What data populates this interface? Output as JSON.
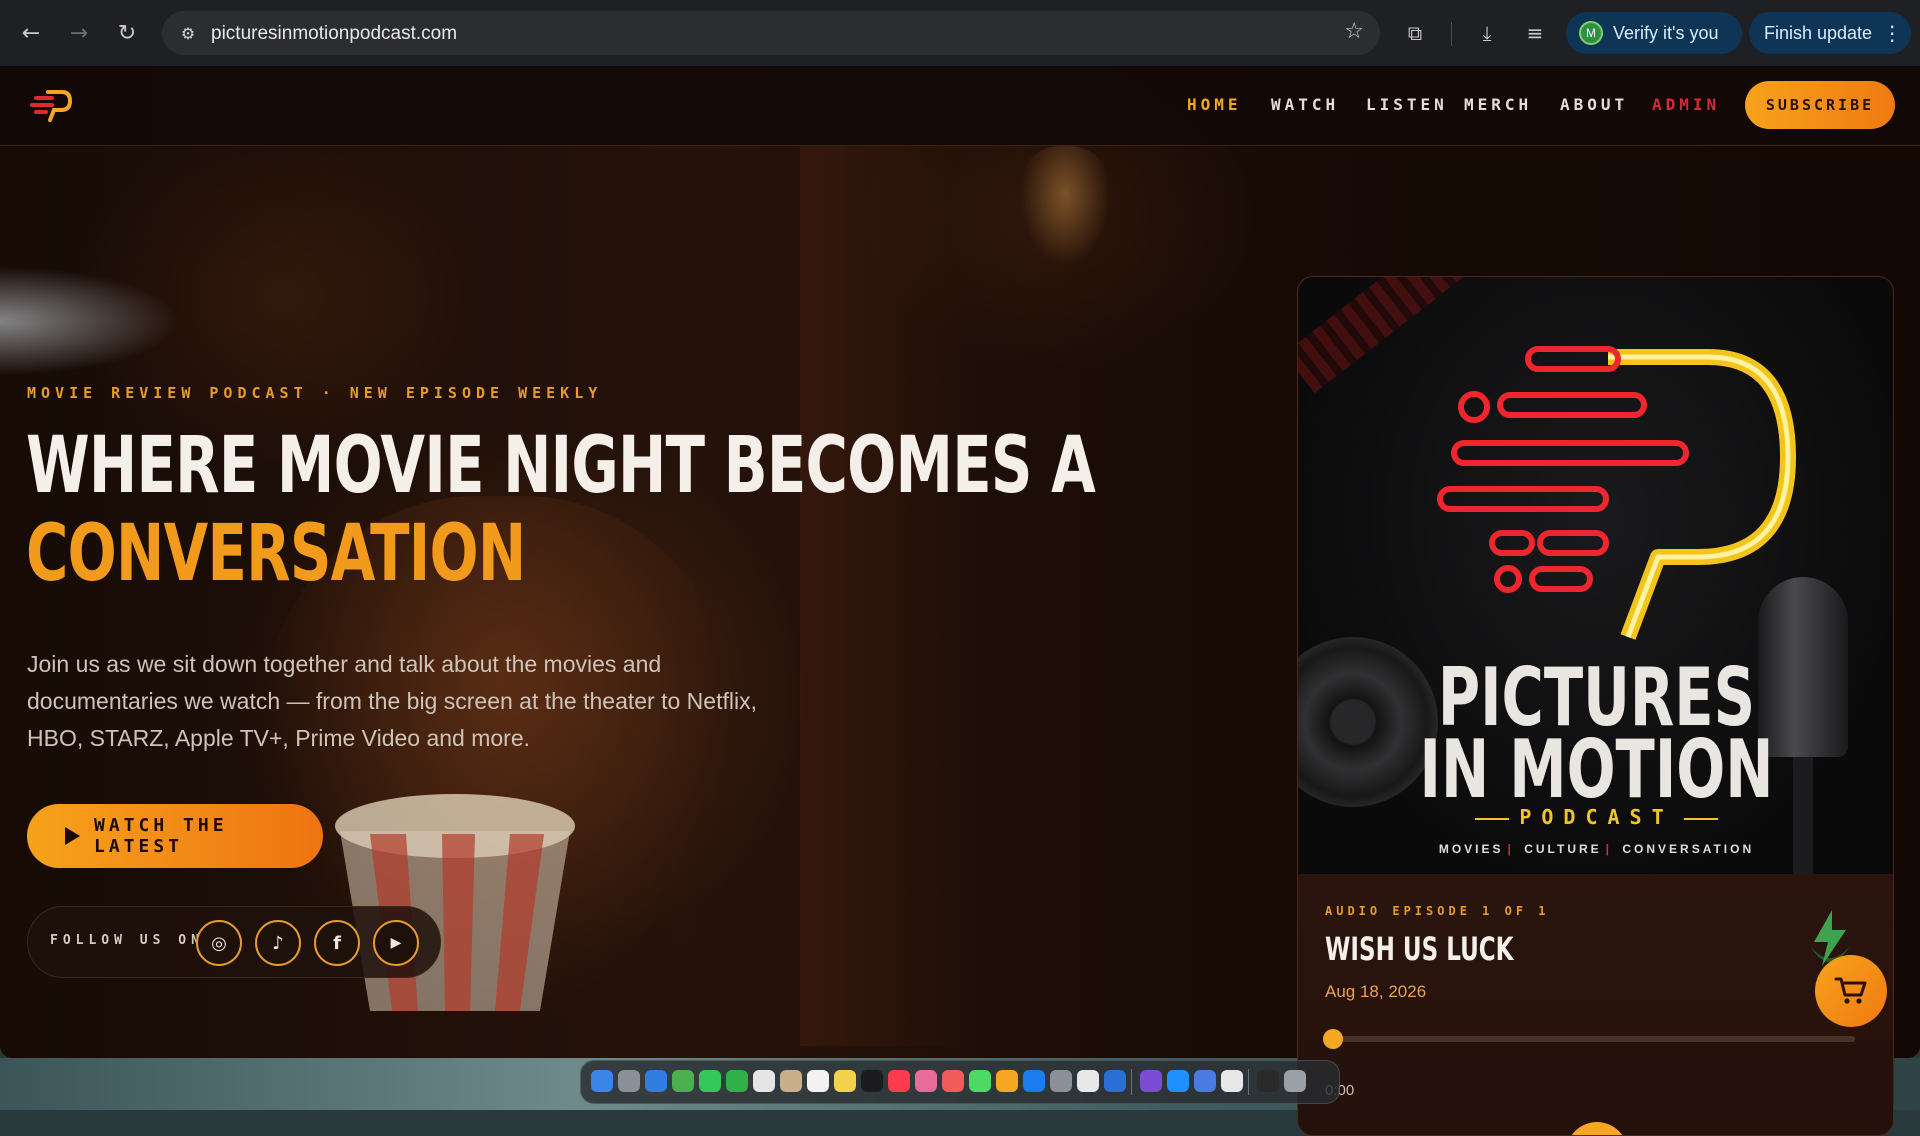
{
  "browser": {
    "back_icon": "←",
    "forward_icon": "→",
    "reload_icon": "↻",
    "site_info_icon": "⚙",
    "url": "picturesinmotionpodcast.com",
    "bookmark_icon": "☆",
    "extensions_icon": "⧉",
    "downloads_icon": "⤓",
    "media_icon": "≡",
    "verify_avatar": "M",
    "verify_label": "Verify it's you",
    "update_label": "Finish update",
    "update_menu_icon": "⋮"
  },
  "nav": {
    "items": [
      {
        "label": "HOME"
      },
      {
        "label": "WATCH"
      },
      {
        "label": "LISTEN"
      },
      {
        "label": "MERCH"
      },
      {
        "label": "ABOUT"
      },
      {
        "label": "ADMIN"
      }
    ],
    "subscribe_label": "SUBSCRIBE"
  },
  "hero": {
    "eyebrow": "MOVIE REVIEW PODCAST · NEW EPISODE WEEKLY",
    "headline_line1": "WHERE MOVIE NIGHT BECOMES A",
    "headline_line2": "CONVERSATION",
    "lede": "Join us as we sit down together and talk about the movies and documentaries we watch — from the big screen at the theater to Netflix, HBO, STARZ, Apple TV+, Prime Video and more.",
    "cta_label": "WATCH THE LATEST",
    "follow_label": "FOLLOW US ON",
    "socials": [
      {
        "name": "instagram",
        "glyph": "◎"
      },
      {
        "name": "tiktok",
        "glyph": "♪"
      },
      {
        "name": "facebook",
        "glyph": "f"
      },
      {
        "name": "youtube",
        "glyph": "▶"
      }
    ]
  },
  "episode": {
    "cover_title_line1": "PICTURES",
    "cover_title_line2": "IN MOTION",
    "cover_sub": "PODCAST",
    "cover_tags": [
      "MOVIES",
      "CULTURE",
      "CONVERSATION"
    ],
    "eyebrow": "AUDIO EPISODE 1 OF 1",
    "title": "WISH US LUCK",
    "date": "Aug 18, 2026",
    "current_time": "0:00",
    "progress": 0
  },
  "colors": {
    "accent": "#f5a623",
    "admin": "#d62839"
  }
}
